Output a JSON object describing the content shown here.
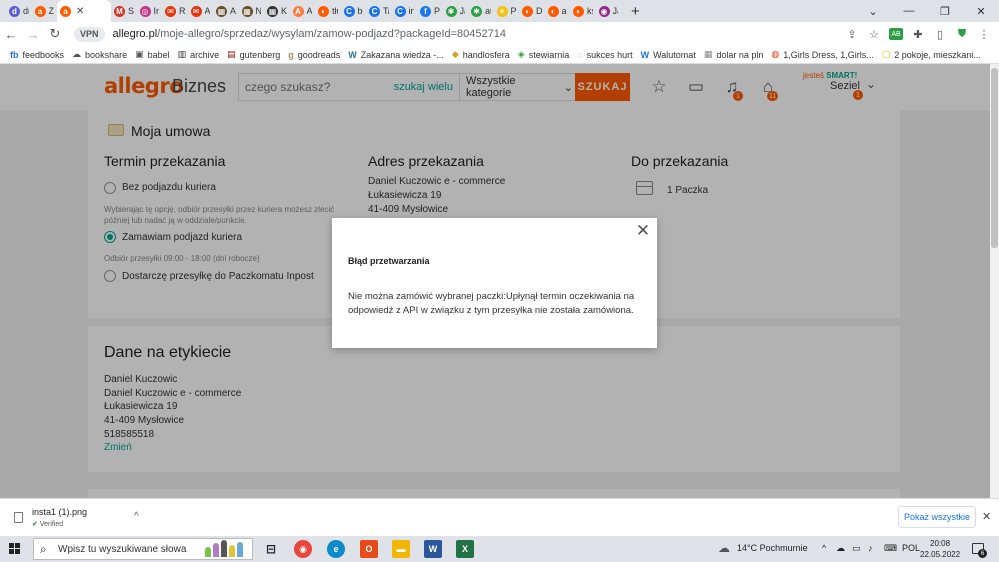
{
  "browser": {
    "tabs": [
      {
        "label": "drı",
        "fav": "#5b5bd6",
        "glyph": "d"
      },
      {
        "label": "Za",
        "fav": "#ff5a00",
        "glyph": "a"
      },
      {
        "label": "",
        "fav": "#ff5a00",
        "glyph": "a",
        "active": true
      },
      {
        "label": "Sp",
        "fav": "#d93025",
        "glyph": "M"
      },
      {
        "label": "Ins",
        "fav": "#c13584",
        "glyph": "◎"
      },
      {
        "label": "Re",
        "fav": "#e8330b",
        "glyph": "✉"
      },
      {
        "label": "Ali",
        "fav": "#e8330b",
        "glyph": "✉"
      },
      {
        "label": "An",
        "fav": "#6b4f2a",
        "glyph": "▦"
      },
      {
        "label": "Na",
        "fav": "#6b4f2a",
        "glyph": "▦"
      },
      {
        "label": "KD",
        "fav": "#333333",
        "glyph": "▦"
      },
      {
        "label": "An",
        "fav": "#ff7a3d",
        "glyph": "A"
      },
      {
        "label": "tłu",
        "fav": "#ff5a00",
        "glyph": "◐"
      },
      {
        "label": "bo",
        "fav": "#1a73e8",
        "glyph": "C"
      },
      {
        "label": "Tal",
        "fav": "#1a73e8",
        "glyph": "C"
      },
      {
        "label": "ins",
        "fav": "#1a73e8",
        "glyph": "C"
      },
      {
        "label": "Pri",
        "fav": "#1877f2",
        "glyph": "f"
      },
      {
        "label": "Jal",
        "fav": "#2e9e44",
        "glyph": "✱"
      },
      {
        "label": "au",
        "fav": "#2e9e44",
        "glyph": "✱"
      },
      {
        "label": "Pa",
        "fav": "#f4c20d",
        "glyph": "✳"
      },
      {
        "label": "Dl",
        "fav": "#ff5a00",
        "glyph": "◐"
      },
      {
        "label": "a5",
        "fav": "#ff5a00",
        "glyph": "◐"
      },
      {
        "label": "ksi",
        "fav": "#ff5a00",
        "glyph": "◐"
      },
      {
        "label": "Jal",
        "fav": "#8e2a8e",
        "glyph": "◉"
      }
    ],
    "active_tab_close": "✕",
    "new_tab": "+",
    "vpn": "VPN",
    "url_host": "allegro.pl",
    "url_path": "/moje-allegro/sprzedaz/wysylam/zamow-podjazd?packageId=80452714",
    "bookmarks": [
      {
        "label": "feedbooks",
        "color": "#1a73e8",
        "glyph": "fb"
      },
      {
        "label": "bookshare",
        "color": "#555555",
        "glyph": "☁"
      },
      {
        "label": "babel",
        "color": "#555555",
        "glyph": "▣"
      },
      {
        "label": "archive",
        "color": "#333333",
        "glyph": "▥"
      },
      {
        "label": "gutenberg",
        "color": "#8b1a1a",
        "glyph": "▤"
      },
      {
        "label": "goodreads",
        "color": "#b08d57",
        "glyph": "g"
      },
      {
        "label": "Zakazana wiedza -...",
        "color": "#21759b",
        "glyph": "W"
      },
      {
        "label": "handlosfera",
        "color": "#d4a017",
        "glyph": "◆"
      },
      {
        "label": "stewiarnia",
        "color": "#2e9e44",
        "glyph": "◈"
      },
      {
        "label": "sukces hurt",
        "color": "#777777",
        "glyph": "◌"
      },
      {
        "label": "Walutomat",
        "color": "#1a73e8",
        "glyph": "W"
      },
      {
        "label": "dolar na pln",
        "color": "#888888",
        "glyph": "▦"
      },
      {
        "label": "1,Girls Dress, 1,Girls...",
        "color": "#e8330b",
        "glyph": "◍"
      },
      {
        "label": "2 pokoje, mieszkani...",
        "color": "#d4c40d",
        "glyph": "▢"
      }
    ]
  },
  "site": {
    "logo": "allegro",
    "logo_suffix": "Biznes",
    "search_placeholder": "czego szukasz?",
    "search_wide": "szukaj wielu",
    "category": "Wszystkie kategorie",
    "search_button": "SZUKAJ",
    "notifications_count": "1",
    "cart_count": "11",
    "smart_prefix": "jesteś",
    "smart_label": "SMART!",
    "user_name": "Seziel",
    "user_badge": "1"
  },
  "contract": {
    "title": "Moja umowa",
    "termin": {
      "heading": "Termin przekazania",
      "option1": "Bez podjazdu kuriera",
      "option1_hint_1": "Wybierając tę opcję, odbiór przesyłki przez kuriera możesz zlecić",
      "option1_hint_2": "później lub nadać ją w oddziale/punkcie.",
      "option2": "Zamawiam podjazd kuriera",
      "option2_hint": "Odbiór przesyłki 09:00 - 18:00 (dni robocze)",
      "option3": "Dostarczę przesyłkę do Paczkomatu Inpost"
    },
    "adres": {
      "heading": "Adres przekazania",
      "line1": "Daniel Kuczowic e - commerce",
      "line2": "Łukasiewicza 19",
      "line3": "41-409 Mysłowice"
    },
    "do": {
      "heading": "Do przekazania",
      "count": "1 Paczka"
    }
  },
  "label": {
    "heading": "Dane na etykiecie",
    "line1": "Daniel Kuczowic",
    "line2": "Daniel Kuczowic e - commerce",
    "line3": "Łukasiewicza 19",
    "line4": "41-409 Mysłowice",
    "line5": "518585518",
    "change": "Zmień"
  },
  "modal": {
    "close": "✕",
    "title": "Błąd przetwarzania",
    "message": "Nie można zamówić wybranej paczki:Upłynął termin oczekiwania na odpowiedź z API w związku z tym przesyłka nie została zamówiona."
  },
  "download": {
    "filename": "insta1 (1).png",
    "status": "Verified",
    "show_all": "Pokaż wszystkie",
    "close": "✕"
  },
  "taskbar": {
    "search_placeholder": "Wpisz tu wyszukiwane słowa",
    "weather": "14°C  Pochmurnie",
    "lang": "POL",
    "time": "20:08",
    "date": "22.05.2022",
    "notif_count": "6"
  }
}
